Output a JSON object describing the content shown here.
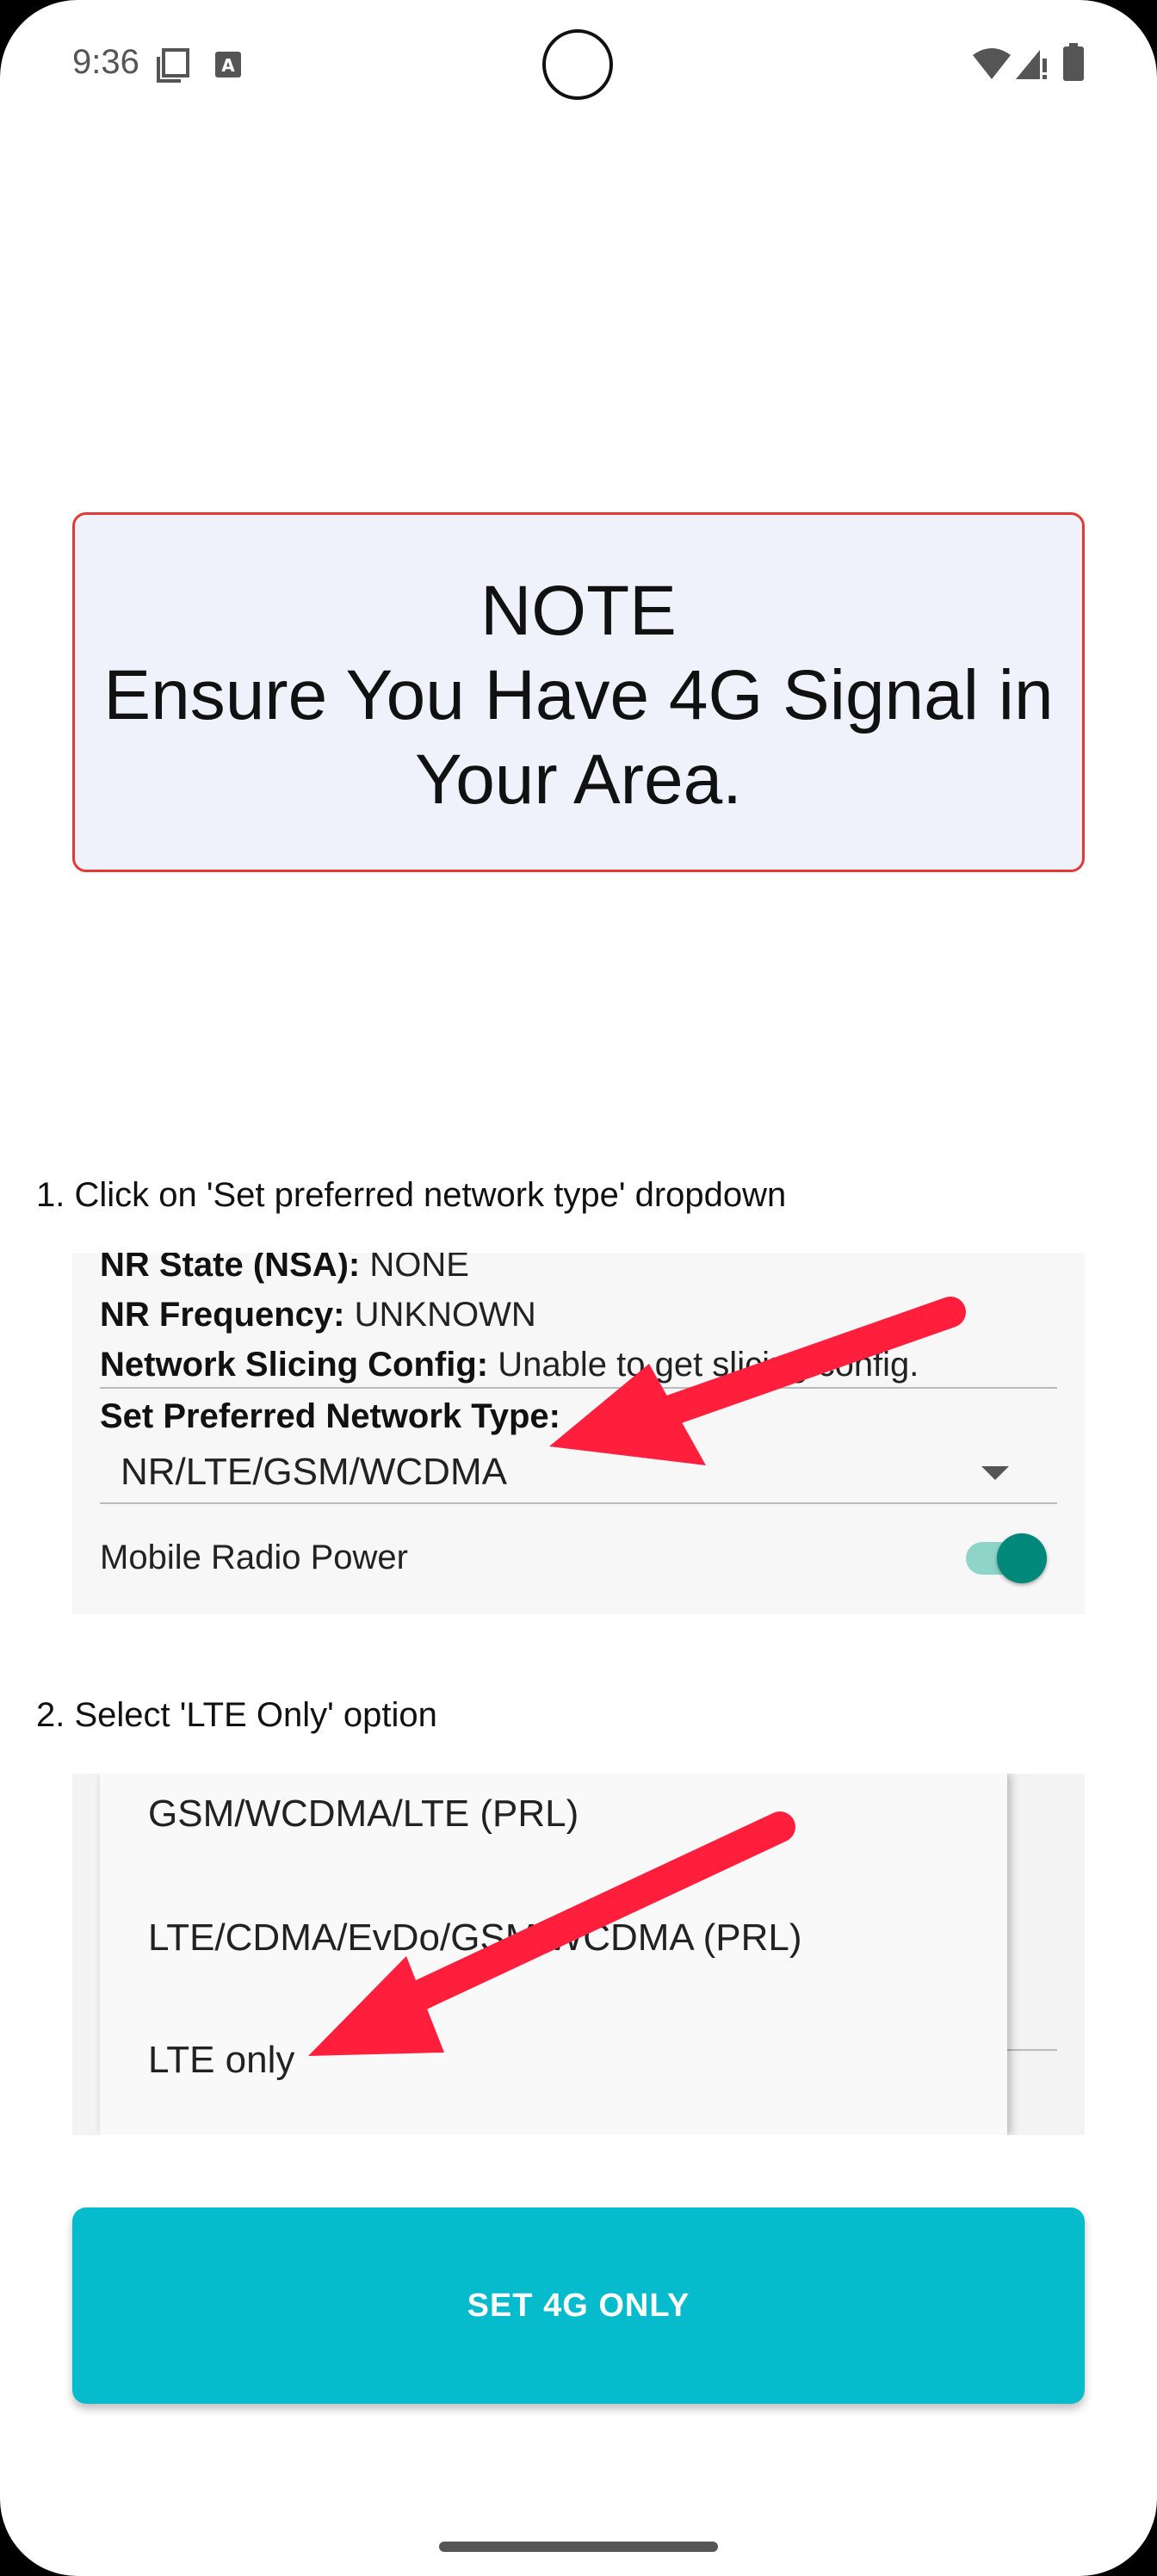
{
  "status_bar": {
    "time": "9:36",
    "icons": [
      "clipboard-icon",
      "font-a-icon",
      "wifi-icon",
      "signal-icon",
      "battery-icon"
    ]
  },
  "note": {
    "line1": "NOTE",
    "line2": "Ensure You Have 4G Signal in",
    "line3": "Your Area."
  },
  "step1": {
    "text": "1. Click on 'Set preferred network type' dropdown",
    "rows": [
      {
        "label": "NR State (NSA):",
        "value": " NONE"
      },
      {
        "label": "NR Frequency:",
        "value": " UNKNOWN"
      },
      {
        "label": "Network Slicing Config:",
        "value": " Unable to get slicing config."
      },
      {
        "label": "Set Preferred Network Type:",
        "value": ""
      }
    ],
    "dropdown_value": "NR/LTE/GSM/WCDMA",
    "radio_power_label": "Mobile Radio Power",
    "radio_power_on": true
  },
  "step2": {
    "text": "2. Select 'LTE Only' option",
    "options": [
      "GSM/WCDMA/LTE (PRL)",
      "LTE/CDMA/EvDo/GSM/WCDMA (PRL)",
      "LTE only"
    ]
  },
  "action_button": "SET 4G ONLY",
  "colors": {
    "accent": "#06bccc",
    "note_border": "#e53935",
    "note_bg": "#eff1fb",
    "arrow": "#ff1f3d",
    "toggle": "#00897b"
  }
}
